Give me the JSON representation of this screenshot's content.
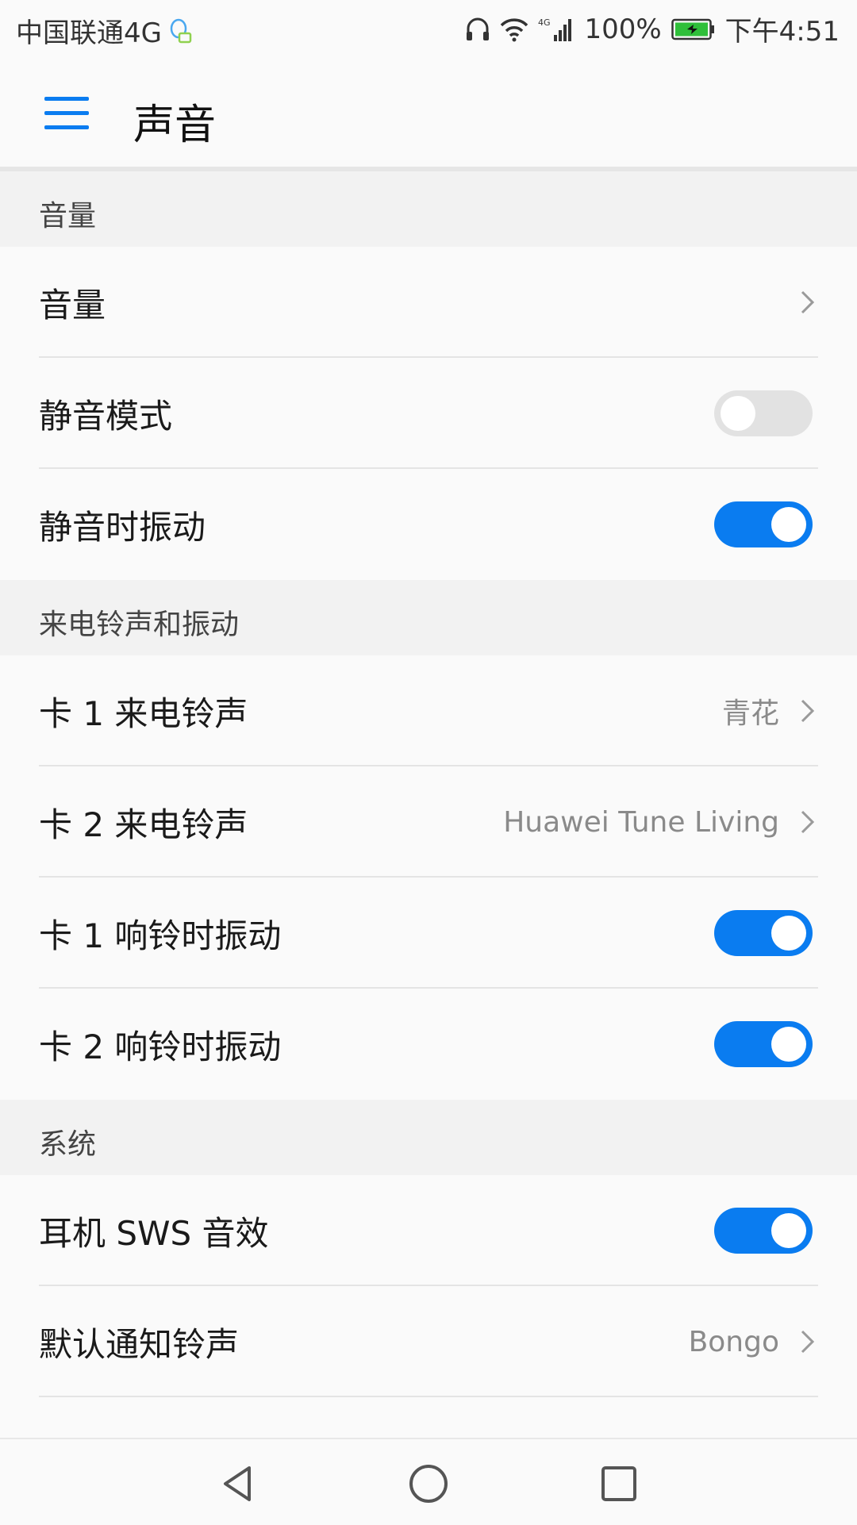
{
  "status_bar": {
    "carrier": "中国联通4G",
    "battery": "100%",
    "time": "下午4:51"
  },
  "app_bar": {
    "title": "声音"
  },
  "sections": [
    {
      "header": "音量",
      "rows": [
        {
          "label": "音量",
          "kind": "chevron"
        },
        {
          "label": "静音模式",
          "kind": "toggle",
          "on": false
        },
        {
          "label": "静音时振动",
          "kind": "toggle",
          "on": true
        }
      ]
    },
    {
      "header": "来电铃声和振动",
      "rows": [
        {
          "label": "卡 1 来电铃声",
          "kind": "chevron",
          "value": "青花"
        },
        {
          "label": "卡 2 来电铃声",
          "kind": "chevron",
          "value": "Huawei Tune Living"
        },
        {
          "label": "卡 1 响铃时振动",
          "kind": "toggle",
          "on": true
        },
        {
          "label": "卡 2 响铃时振动",
          "kind": "toggle",
          "on": true
        }
      ]
    },
    {
      "header": "系统",
      "rows": [
        {
          "label": "耳机 SWS 音效",
          "kind": "toggle",
          "on": true
        },
        {
          "label": "默认通知铃声",
          "kind": "chevron",
          "value": "Bongo"
        }
      ]
    }
  ],
  "colors": {
    "accent": "#0a7cf0",
    "toggle_off": "#e2e2e2",
    "section_bg": "#f2f2f2"
  }
}
